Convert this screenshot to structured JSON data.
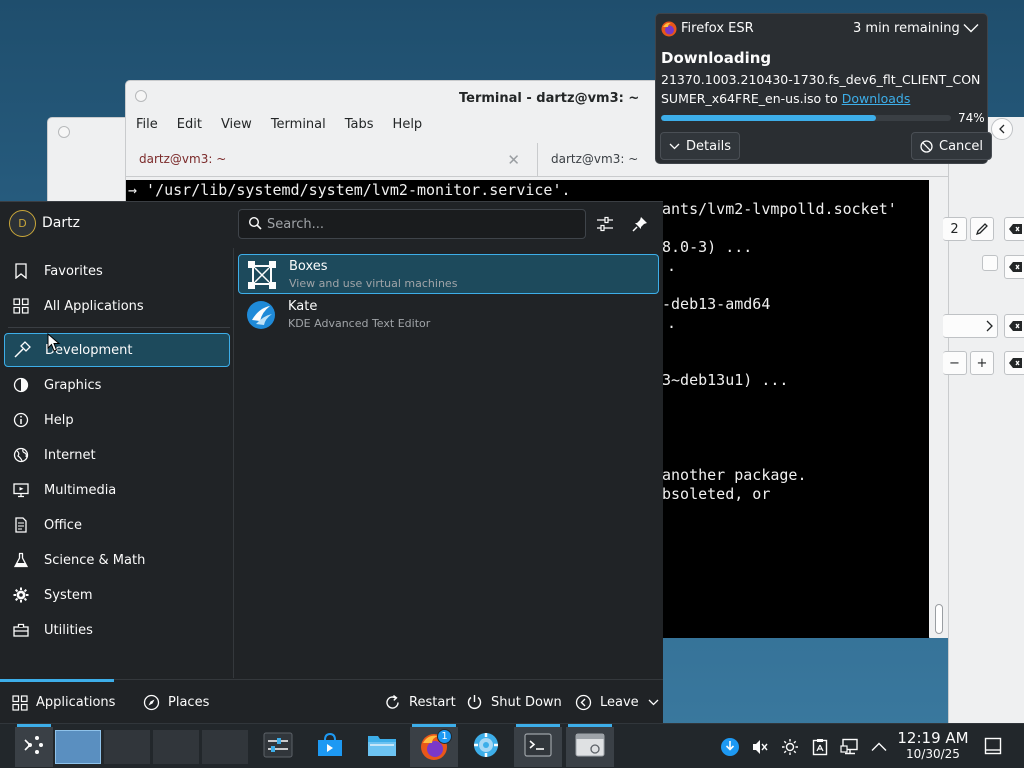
{
  "terminal": {
    "title": "Terminal - dartz@vm3: ~",
    "menu": [
      "File",
      "Edit",
      "View",
      "Terminal",
      "Tabs",
      "Help"
    ],
    "tabs": [
      {
        "label": "dartz@vm3: ~"
      },
      {
        "label": "dartz@vm3: ~"
      }
    ],
    "lines": [
      {
        "text": "→ '/usr/lib/systemd/system/lvm2-monitor.service'."
      },
      {
        "text": "ants/lvm2-lvmpolld.socket'"
      },
      {
        "text": "8.0-3) ..."
      },
      {
        "text": "."
      },
      {
        "text": "-deb13-amd64"
      },
      {
        "text": "."
      },
      {
        "text": "3~deb13u1) ..."
      },
      {
        "text": "another package."
      },
      {
        "text": "bsoleted, or"
      }
    ]
  },
  "settings_strip": {
    "controls": [
      "2",
      "−",
      "+"
    ]
  },
  "launcher": {
    "user": {
      "name": "Dartz",
      "initial": "D"
    },
    "search_placeholder": "Search...",
    "categories": [
      {
        "label": "Favorites",
        "icon": "bookmark-icon"
      },
      {
        "label": "All Applications",
        "icon": "grid-icon"
      },
      {
        "label": "Development",
        "icon": "hammer-icon"
      },
      {
        "label": "Graphics",
        "icon": "palette-icon"
      },
      {
        "label": "Help",
        "icon": "info-icon"
      },
      {
        "label": "Internet",
        "icon": "globe-icon"
      },
      {
        "label": "Multimedia",
        "icon": "monitor-icon"
      },
      {
        "label": "Office",
        "icon": "document-icon"
      },
      {
        "label": "Science & Math",
        "icon": "flask-icon"
      },
      {
        "label": "System",
        "icon": "gear-icon"
      },
      {
        "label": "Utilities",
        "icon": "toolbox-icon"
      }
    ],
    "selected_category": "Development",
    "apps": [
      {
        "name": "Boxes",
        "description": "View and use virtual machines",
        "icon": "boxes-icon"
      },
      {
        "name": "Kate",
        "description": "KDE Advanced Text Editor",
        "icon": "kate-icon"
      }
    ],
    "footer": {
      "applications": "Applications",
      "places": "Places",
      "restart": "Restart",
      "shutdown": "Shut Down",
      "leave": "Leave"
    }
  },
  "notification": {
    "app_name": "Firefox ESR",
    "remaining": "3 min remaining",
    "heading": "Downloading",
    "body_text": "21370.1003.210430-1730.fs_dev6_flt_CLIENT_CONSUMER_x64FRE_en-us.iso to ",
    "link_text": "Downloads",
    "progress_label": "74%",
    "progress_fraction": 0.74,
    "details_label": "Details",
    "cancel_label": "Cancel"
  },
  "taskbar": {
    "firefox_badge": "1",
    "clock_time": "12:19 AM",
    "clock_date": "10/30/25"
  },
  "colors": {
    "accent": "#3daee9",
    "panel": "#202326",
    "selection": "#1d4a5c"
  }
}
